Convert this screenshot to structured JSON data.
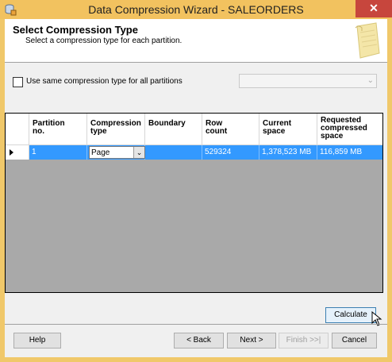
{
  "window": {
    "title": "Data Compression Wizard - SALEORDERS",
    "close_symbol": "✕"
  },
  "header": {
    "title": "Select Compression Type",
    "subtitle": "Select a compression type for each partition."
  },
  "options": {
    "same_type_label": "Use same compression type for all partitions",
    "same_type_checked": false,
    "same_type_select_value": ""
  },
  "grid": {
    "columns": [
      "Partition no.",
      "Compression type",
      "Boundary",
      "Row count",
      "Current space",
      "Requested compressed space"
    ],
    "columns_display": [
      [
        "Partition",
        "no."
      ],
      [
        "Compression",
        "type"
      ],
      [
        "Boundary"
      ],
      [
        "Row",
        "count"
      ],
      [
        "Current",
        "space"
      ],
      [
        "Requested",
        "compressed",
        "space"
      ]
    ],
    "rows": [
      {
        "partition_no": "1",
        "compression_type": "Page",
        "boundary": "",
        "row_count": "529324",
        "current_space": "1,378,523 MB",
        "requested_space": "116,859 MB",
        "selected": true
      }
    ]
  },
  "buttons": {
    "calculate": "Calculate",
    "help": "Help",
    "back": "< Back",
    "next": "Next >",
    "finish": "Finish >>|",
    "cancel": "Cancel"
  },
  "colors": {
    "title_bar": "#f2c25f",
    "close_button": "#c7463d",
    "selection": "#3399ff",
    "grid_background": "#a9a9a9"
  }
}
